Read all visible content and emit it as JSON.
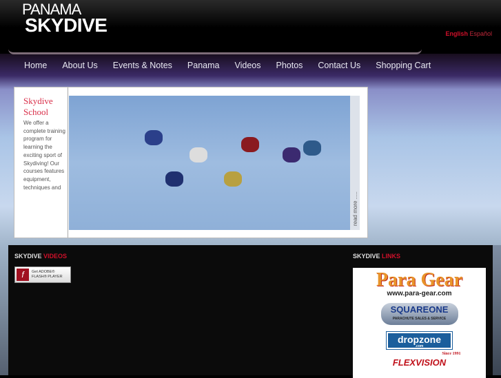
{
  "logo": {
    "line1": "PANAMA",
    "line2": "SKYDIVE"
  },
  "language": {
    "english": "English",
    "spanish": "Español"
  },
  "nav": [
    "Home",
    "About Us",
    "Events & Notes",
    "Panama",
    "Videos",
    "Photos",
    "Contact Us",
    "Shopping Cart"
  ],
  "feature": {
    "title_line1": "Skydive",
    "title_line2": "School",
    "text": "We offer a complete training program for learning the exciting sport of Skydiving!  Our courses features equipment, techniques and",
    "read_more": "read more ....."
  },
  "videos": {
    "heading_white": "SKYDIVE",
    "heading_red": "VIDEOS",
    "flash_line1": "Get ADOBE®",
    "flash_line2": "FLASH® PLAYER",
    "flash_icon": "f"
  },
  "links": {
    "heading_white": "SKYDIVE",
    "heading_red": "LINKS",
    "paragear": "Para Gear",
    "paragear_url": "www.para-gear.com",
    "squareone": "SQUAREONE",
    "squareone_sub": "PARACHUTE SALES & SERVICE",
    "dropzone": "dropzone",
    "dropzone_sub": ".com",
    "flexvision": "FLEXVISION",
    "flexvision_since": "Since 1991"
  }
}
